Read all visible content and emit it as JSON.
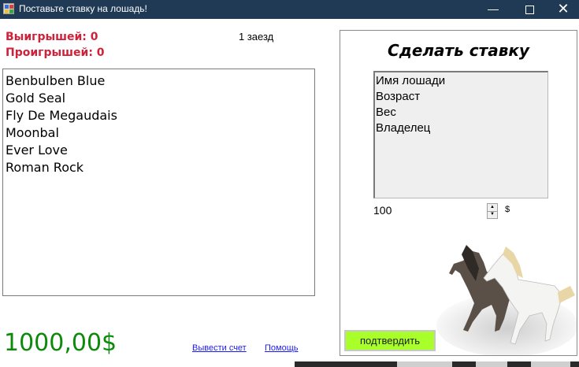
{
  "window": {
    "title": "Поставьте ставку на лошадь!",
    "minimize_glyph": "—",
    "close_glyph": "✕",
    "icon": "app-icon"
  },
  "stats": {
    "wins": "Выигрышей: 0",
    "losses": "Проигрышей: 0",
    "race": "1 заезд"
  },
  "horses": [
    "Benbulben Blue",
    "Gold Seal",
    "Fly De Megaudais",
    "Moonbal",
    "Ever Love",
    "Roman Rock"
  ],
  "balance": "1000,00$",
  "links": {
    "withdraw": "Вывести счет",
    "help": "Помощь"
  },
  "bet_panel": {
    "title": "Сделать ставку",
    "info_fields": [
      "Имя лошади",
      "Возраст",
      "Вес",
      "Владелец"
    ],
    "amount": "100",
    "spin_up": "▲",
    "spin_down": "▼",
    "currency": "$",
    "confirm_label": "подтвердить",
    "image": "horses-image"
  },
  "colors": {
    "titlebar": "#203a55",
    "stats_red": "#d0213a",
    "balance_green": "#0b8a0b",
    "link_blue": "#1a1aff",
    "confirm_green": "#a8ff2a"
  }
}
